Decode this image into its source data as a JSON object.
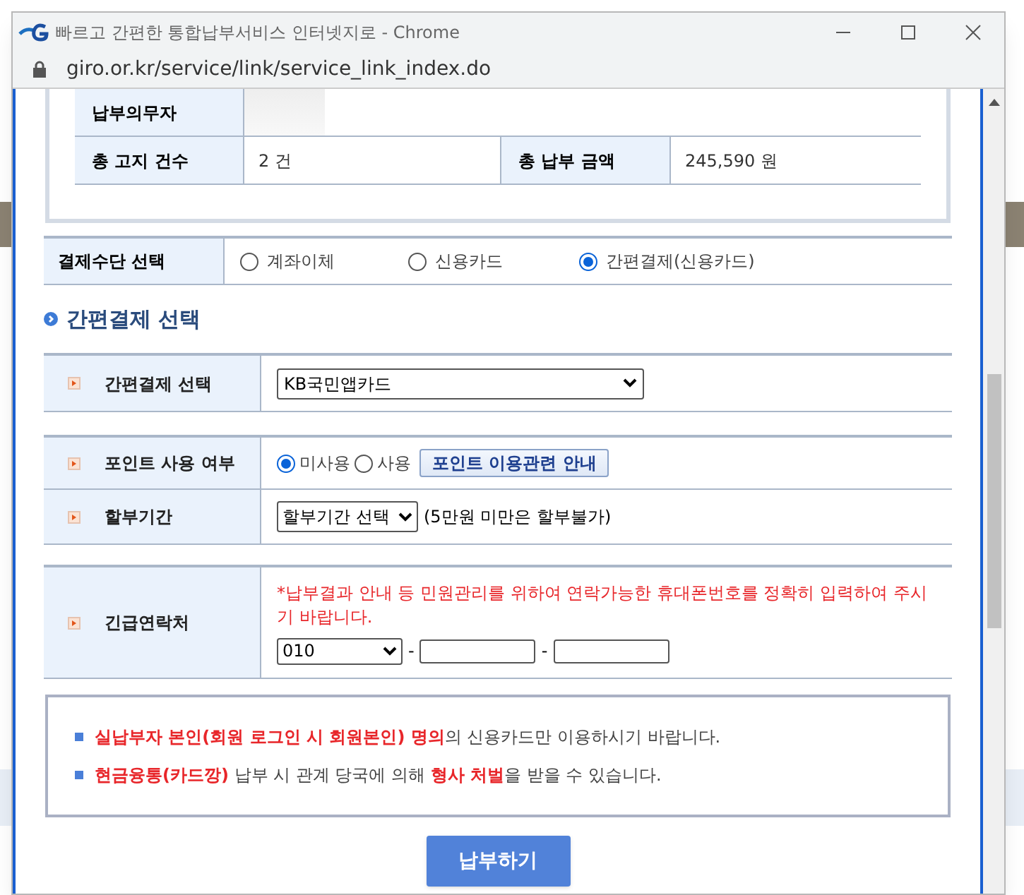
{
  "window": {
    "title": "빠르고 간편한 통합납부서비스 인터넷지로 - Chrome",
    "url": "giro.or.kr/service/link/service_link_index.do"
  },
  "summary": {
    "payer_label": "납부의무자",
    "count_label": "총 고지 건수",
    "count": "2 건",
    "amount_label": "총 납부 금액",
    "amount": "245,590 원"
  },
  "payment_method": {
    "label": "결제수단 선택",
    "options": [
      {
        "label": "계좌이체",
        "selected": false
      },
      {
        "label": "신용카드",
        "selected": false
      },
      {
        "label": "간편결제(신용카드)",
        "selected": true
      }
    ]
  },
  "section_title": "간편결제 선택",
  "easy_pay": {
    "label": "간편결제 선택",
    "value": "KB국민앱카드"
  },
  "points": {
    "label": "포인트 사용 여부",
    "options": [
      {
        "label": "미사용",
        "selected": true
      },
      {
        "label": "사용",
        "selected": false
      }
    ],
    "guide_button": "포인트 이용관련 안내"
  },
  "installment": {
    "label": "할부기간",
    "value": "할부기간 선택",
    "note": "(5만원 미만은 할부불가)"
  },
  "contact": {
    "label": "긴급연락처",
    "notice": "*납부결과 안내 등 민원관리를 위하여 연락가능한 휴대폰번호를 정확히 입력하여 주시기 바랍니다.",
    "prefix": "010",
    "separators": [
      "-",
      "-"
    ]
  },
  "notices": [
    {
      "segments": [
        {
          "text": "실납부자 본인(회원 로그인 시 회원본인) 명의",
          "emphasis": true
        },
        {
          "text": "의 신용카드만 이용하시기 바랍니다.",
          "emphasis": false
        }
      ]
    },
    {
      "segments": [
        {
          "text": "현금융통(카드깡)",
          "emphasis": true
        },
        {
          "text": " 납부 시 관계 당국에 의해 ",
          "emphasis": false
        },
        {
          "text": "형사 처벌",
          "emphasis": true
        },
        {
          "text": "을 받을 수 있습니다.",
          "emphasis": false
        }
      ]
    }
  ],
  "submit_button": "납부하기"
}
